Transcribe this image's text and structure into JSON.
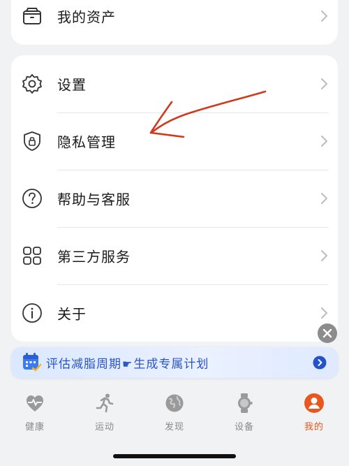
{
  "assets_row": {
    "label": "我的资产",
    "icon": "wallet-icon"
  },
  "settings_list": [
    {
      "label": "设置",
      "icon": "gear-icon"
    },
    {
      "label": "隐私管理",
      "icon": "privacy-shield-icon"
    },
    {
      "label": "帮助与客服",
      "icon": "help-circle-icon"
    },
    {
      "label": "第三方服务",
      "icon": "apps-grid-icon"
    },
    {
      "label": "关于",
      "icon": "info-icon"
    }
  ],
  "promo": {
    "text_part1": "评估减脂周期",
    "text_part2": "生成专属计划",
    "icon": "calendar-check-icon",
    "accent": "#2a55c9"
  },
  "tabs": [
    {
      "label": "健康",
      "icon": "heart-pulse-icon"
    },
    {
      "label": "运动",
      "icon": "running-icon"
    },
    {
      "label": "发现",
      "icon": "globe-icon"
    },
    {
      "label": "设备",
      "icon": "watch-icon"
    },
    {
      "label": "我的",
      "icon": "profile-icon",
      "active": true
    }
  ],
  "colors": {
    "active_tab": "#e8571f",
    "annotation_arrow": "#d0391d",
    "background": "#f1f2f4"
  }
}
